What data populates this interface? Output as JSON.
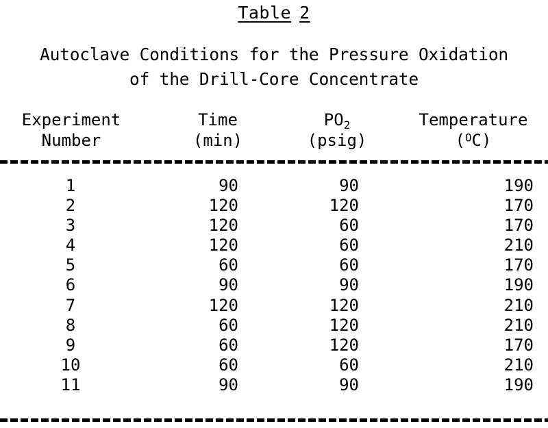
{
  "document": {
    "title_label": "Table",
    "title_number": "2",
    "subtitle_line1": "Autoclave Conditions for the Pressure Oxidation",
    "subtitle_line2": "of the Drill-Core Concentrate"
  },
  "table": {
    "headers": [
      {
        "line1": "Experiment",
        "line2": "Number"
      },
      {
        "line1": "Time",
        "line2": "(min)"
      },
      {
        "line1": "PO",
        "line1_sub": "2",
        "line2": "(psig)"
      },
      {
        "line1": "Temperature",
        "line2_pre": "(",
        "line2_sup": "O",
        "line2_post": "C)"
      }
    ],
    "columns": [
      "Experiment Number",
      "Time (min)",
      "PO2 (psig)",
      "Temperature (C)"
    ],
    "rows": [
      {
        "experiment": "1",
        "time": "90",
        "po2": "90",
        "temperature": "190"
      },
      {
        "experiment": "2",
        "time": "120",
        "po2": "120",
        "temperature": "170"
      },
      {
        "experiment": "3",
        "time": "120",
        "po2": "60",
        "temperature": "170"
      },
      {
        "experiment": "4",
        "time": "120",
        "po2": "60",
        "temperature": "210"
      },
      {
        "experiment": "5",
        "time": "60",
        "po2": "60",
        "temperature": "170"
      },
      {
        "experiment": "6",
        "time": "90",
        "po2": "90",
        "temperature": "190"
      },
      {
        "experiment": "7",
        "time": "120",
        "po2": "120",
        "temperature": "210"
      },
      {
        "experiment": "8",
        "time": "60",
        "po2": "120",
        "temperature": "210"
      },
      {
        "experiment": "9",
        "time": "60",
        "po2": "120",
        "temperature": "170"
      },
      {
        "experiment": "10",
        "time": "60",
        "po2": "60",
        "temperature": "210"
      },
      {
        "experiment": "11",
        "time": "90",
        "po2": "90",
        "temperature": "190"
      }
    ]
  },
  "colors": {
    "ink": "#000000",
    "page": "#ffffff"
  }
}
